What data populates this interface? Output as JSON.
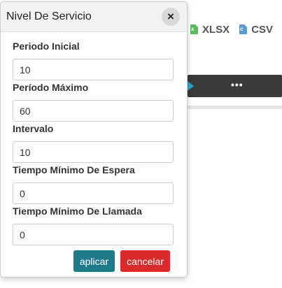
{
  "background": {
    "export_buttons": [
      {
        "label": "XLSX",
        "icon": "xlsx-file-icon",
        "color": "#5cb85c"
      },
      {
        "label": "CSV",
        "icon": "csv-file-icon",
        "color": "#5b9bd5"
      }
    ],
    "more_label": "•••"
  },
  "modal": {
    "title": "Nivel De Servicio",
    "close_label": "×",
    "fields": [
      {
        "label": "Periodo Inicial",
        "value": "10"
      },
      {
        "label": "Período Máximo",
        "value": "60"
      },
      {
        "label": "Intervalo",
        "value": "10"
      },
      {
        "label": "Tiempo Mínimo De Espera",
        "value": "0"
      },
      {
        "label": "Tiempo Mínimo De Llamada",
        "value": "0"
      }
    ],
    "apply_label": "aplicar",
    "cancel_label": "cancelar",
    "apply_color": "#1f7a8c",
    "cancel_color": "#d92b2b"
  }
}
